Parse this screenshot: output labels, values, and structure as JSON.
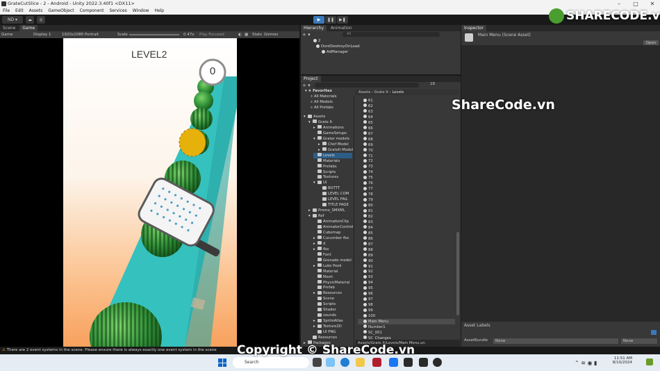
{
  "window": {
    "title": "GrateCutSlice - 2 - Android - Unity 2022.3.40f1 <DX11>",
    "controls": [
      "–",
      "□",
      "✕"
    ]
  },
  "menu": [
    "File",
    "Edit",
    "Assets",
    "GameObject",
    "Component",
    "Services",
    "Window",
    "Help"
  ],
  "toolbar": {
    "account": "ND ▾",
    "play_icons": [
      "▶",
      "❚❚",
      "▶❚"
    ]
  },
  "tabs": {
    "scene": "Scene",
    "game": "Game",
    "hierarchy": "Hierarchy",
    "animation": "Animation",
    "inspector": "Inspector",
    "project": "Project"
  },
  "gamebar": {
    "mode": "Game",
    "display": "Display 1",
    "resolution": "1920x1080 Portrait",
    "scale_label": "Scale",
    "scale_value": "0.47x",
    "play_focused": "Play Focused",
    "stats": "Stats",
    "gizmos": "Gizmos"
  },
  "game": {
    "level": "LEVEL2",
    "score": "0"
  },
  "hierarchy": {
    "search_placeholder": "All",
    "items": [
      "2",
      "DontDestroyOnLoad",
      "AdManager"
    ]
  },
  "inspector": {
    "title": "Main Menu (Scene Asset)",
    "open": "Open",
    "asset_labels": "Asset Labels",
    "asset_bundle_label": "AssetBundle",
    "asset_bundle_value": "None",
    "asset_variant_value": "None"
  },
  "project": {
    "count": "18",
    "breadcrumb": [
      "Assets",
      "Grate It",
      "Levels"
    ],
    "favorites": [
      "Favorites",
      "All Materials",
      "All Models",
      "All Prefabs"
    ],
    "tree": [
      {
        "label": "Assets",
        "indent": 0,
        "arrow": "▾"
      },
      {
        "label": "Grate It",
        "indent": 1,
        "arrow": "▾"
      },
      {
        "label": "Animations",
        "indent": 2,
        "arrow": "▸"
      },
      {
        "label": "GameSetups",
        "indent": 2,
        "arrow": ""
      },
      {
        "label": "Grater models",
        "indent": 2,
        "arrow": "▾"
      },
      {
        "label": "Chef Model",
        "indent": 3,
        "arrow": "▸"
      },
      {
        "label": "GrateIt Model",
        "indent": 3,
        "arrow": "▸"
      },
      {
        "label": "Levels",
        "indent": 2,
        "arrow": ""
      },
      {
        "label": "Materials",
        "indent": 2,
        "arrow": ""
      },
      {
        "label": "Prefabs",
        "indent": 2,
        "arrow": ""
      },
      {
        "label": "Scripts",
        "indent": 2,
        "arrow": ""
      },
      {
        "label": "Textures",
        "indent": 2,
        "arrow": ""
      },
      {
        "label": "UI",
        "indent": 2,
        "arrow": "▾"
      },
      {
        "label": "BUTTT",
        "indent": 3,
        "arrow": ""
      },
      {
        "label": "LEVEL COM",
        "indent": 3,
        "arrow": ""
      },
      {
        "label": "LEVEL FAIL",
        "indent": 3,
        "arrow": ""
      },
      {
        "label": "TITLE PAGE",
        "indent": 3,
        "arrow": ""
      },
      {
        "label": "Promo_SMXML",
        "indent": 1,
        "arrow": "▸"
      },
      {
        "label": "Ref",
        "indent": 1,
        "arrow": "▾"
      },
      {
        "label": "AnimationClip",
        "indent": 2,
        "arrow": ""
      },
      {
        "label": "AnimatorControl",
        "indent": 2,
        "arrow": ""
      },
      {
        "label": "Cubemap",
        "indent": 2,
        "arrow": ""
      },
      {
        "label": "Cucumber fbx",
        "indent": 2,
        "arrow": "▸"
      },
      {
        "label": "d",
        "indent": 2,
        "arrow": "▸"
      },
      {
        "label": "fbx",
        "indent": 2,
        "arrow": "▸"
      },
      {
        "label": "Font",
        "indent": 2,
        "arrow": ""
      },
      {
        "label": "Grenade model",
        "indent": 2,
        "arrow": ""
      },
      {
        "label": "Luke Peek",
        "indent": 2,
        "arrow": "▸"
      },
      {
        "label": "Material",
        "indent": 2,
        "arrow": ""
      },
      {
        "label": "Mesh",
        "indent": 2,
        "arrow": ""
      },
      {
        "label": "PhysicMaterial",
        "indent": 2,
        "arrow": ""
      },
      {
        "label": "Prefab",
        "indent": 2,
        "arrow": ""
      },
      {
        "label": "Resources",
        "indent": 2,
        "arrow": "▸"
      },
      {
        "label": "Scene",
        "indent": 2,
        "arrow": ""
      },
      {
        "label": "Scripts",
        "indent": 2,
        "arrow": ""
      },
      {
        "label": "Shader",
        "indent": 2,
        "arrow": ""
      },
      {
        "label": "sounds",
        "indent": 2,
        "arrow": ""
      },
      {
        "label": "SpriteAtlas",
        "indent": 2,
        "arrow": "▸"
      },
      {
        "label": "Texture2D",
        "indent": 2,
        "arrow": "▸"
      },
      {
        "label": "UI PNG",
        "indent": 2,
        "arrow": ""
      },
      {
        "label": "Resources",
        "indent": 1,
        "arrow": ""
      },
      {
        "label": "Packages",
        "indent": 0,
        "arrow": "▸"
      }
    ],
    "assets": [
      "61",
      "62",
      "63",
      "64",
      "65",
      "66",
      "67",
      "68",
      "69",
      "70",
      "71",
      "72",
      "73",
      "74",
      "75",
      "76",
      "77",
      "78",
      "79",
      "80",
      "81",
      "82",
      "83",
      "84",
      "85",
      "86",
      "87",
      "88",
      "89",
      "90",
      "91",
      "92",
      "93",
      "94",
      "95",
      "96",
      "97",
      "98",
      "99",
      "100",
      "Main Menu",
      "Number1",
      "SC_001",
      "SC_Changes"
    ],
    "selected_asset": "Main Menu",
    "path": "Assets/Grate It/Levels/Main Menu.un"
  },
  "status": {
    "message": "There are 2 event systems in the scene. Please ensure there is always exactly one event system in the scene"
  },
  "taskbar": {
    "search_placeholder": "Search",
    "time": "11:51 AM",
    "date": "8/10/2024"
  },
  "watermark": {
    "logo": "SHARECODE.vn",
    "center": "ShareCode.vn",
    "bottom": "Copyright © ShareCode.vn"
  },
  "colors": {
    "editor_bg": "#191919",
    "panel_bg": "#383838",
    "selection": "#2c5d87",
    "play_active": "#3a79bb",
    "road": "#35c1be"
  }
}
